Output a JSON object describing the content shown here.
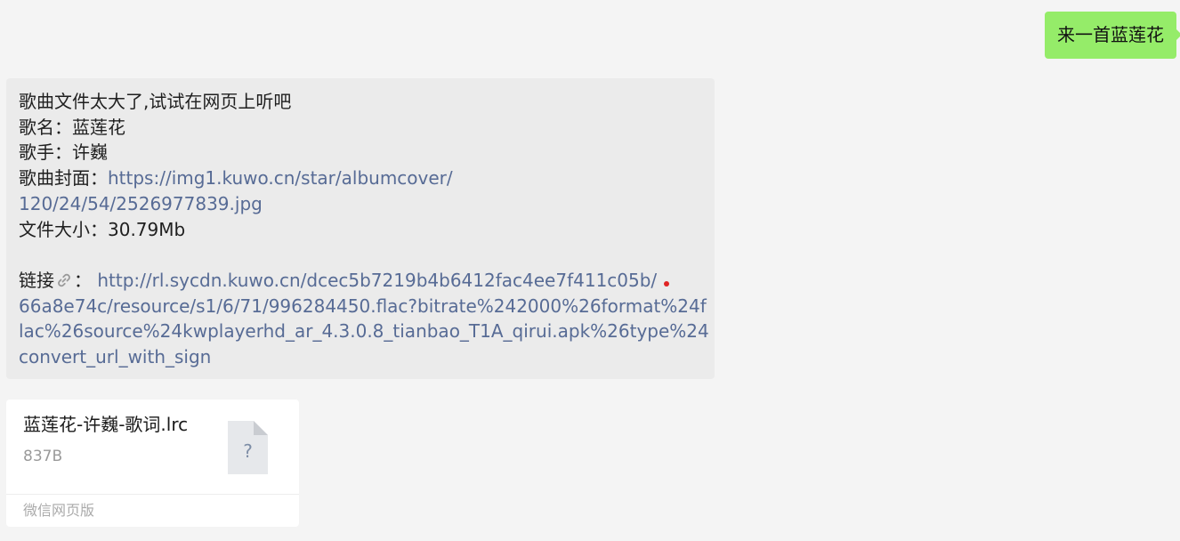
{
  "outgoing": {
    "text": "来一首蓝莲花"
  },
  "incoming": {
    "line1": "歌曲文件太大了,试试在网页上听吧",
    "name_label": "歌名：",
    "name_value": "蓝莲花",
    "singer_label": "歌手：",
    "singer_value": "许巍",
    "cover_label": "歌曲封面：",
    "cover_url_part1": "https://img1.kuwo.cn/star/albumcover/",
    "cover_url_part2": "120/24/54/2526977839.jpg",
    "size_label": "文件大小：",
    "size_value": "30.79Mb",
    "link_label": "链接",
    "link_colon": "：",
    "link_part1": "http://rl.sycdn.kuwo.cn/dcec5b7219b4b6412fac4ee7f411c05b/",
    "link_part2": "66a8e74c/resource/s1/6/71/996284450.flac?bitrate%242000%26format%24f",
    "link_part3": "lac%26source%24kwplayerhd_ar_4.3.0.8_tianbao_T1A_qirui.apk%26type%24",
    "link_part4": "convert_url_with_sign"
  },
  "file_card": {
    "file_name": "蓝莲花-许巍-歌词.lrc",
    "file_size": "837B",
    "icon_glyph": "?",
    "footer": "微信网页版"
  },
  "icons": {
    "chain": "link-chain-icon",
    "file": "unknown-file-icon",
    "dot": "red-dot-icon"
  },
  "colors": {
    "outgoing_bubble": "#95ec69",
    "incoming_bubble": "#ebebeb",
    "link": "#576b95",
    "background": "#f4f4f4",
    "dot": "#e02424"
  }
}
